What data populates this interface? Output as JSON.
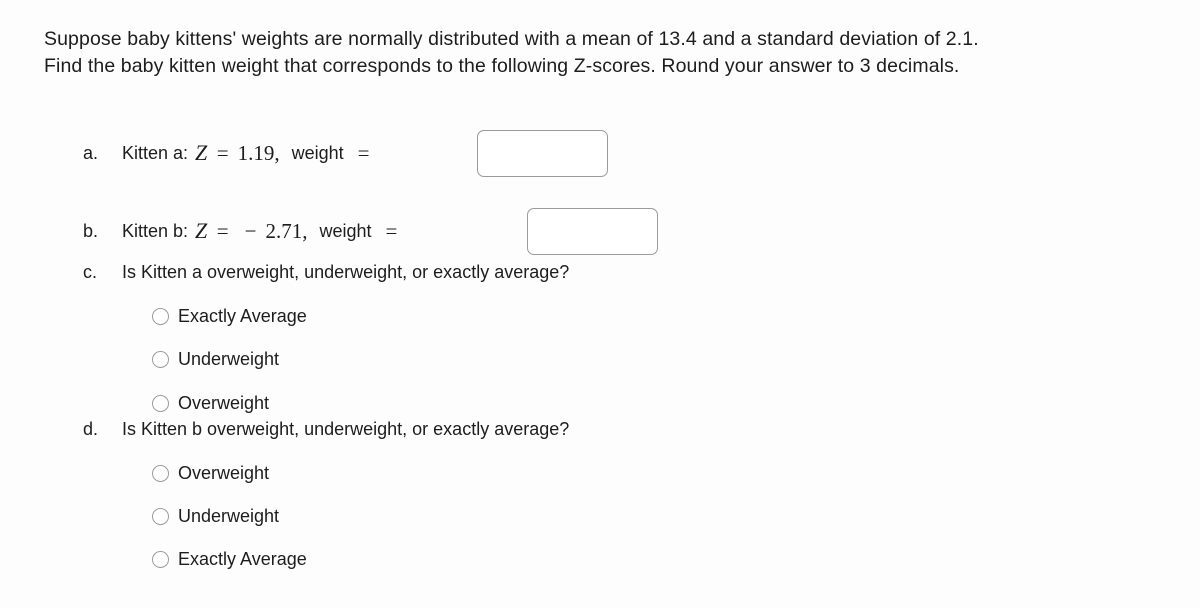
{
  "prompt": {
    "line1": "Suppose baby kittens' weights are normally distributed with a mean of 13.4 and a standard deviation of 2.1.",
    "line2": "Find the baby kitten weight that corresponds to the following Z-scores. Round your answer to 3 decimals."
  },
  "questions": [
    {
      "marker": "a.",
      "lead": "Kitten a:",
      "variable": "Z",
      "equals": "=",
      "zvalue": "1.19,",
      "weight_word": "weight",
      "weight_equals": "=",
      "input_value": "",
      "input_placeholder": ""
    },
    {
      "marker": "b.",
      "lead": "Kitten b:",
      "variable": "Z",
      "equals": "=",
      "minus": "−",
      "zvalue": "2.71,",
      "weight_word": "weight",
      "weight_equals": "=",
      "input_value": "",
      "input_placeholder": ""
    },
    {
      "marker": "c.",
      "question": "Is Kitten a overweight, underweight, or exactly average?",
      "options": [
        {
          "label": "Exactly Average",
          "selected": false
        },
        {
          "label": "Underweight",
          "selected": false
        },
        {
          "label": "Overweight",
          "selected": false
        }
      ]
    },
    {
      "marker": "d.",
      "question": "Is Kitten b overweight, underweight, or exactly average?",
      "options": [
        {
          "label": "Overweight",
          "selected": false
        },
        {
          "label": "Underweight",
          "selected": false
        },
        {
          "label": "Exactly Average",
          "selected": false
        }
      ]
    }
  ],
  "colors": {
    "background": "#fdfdfd",
    "text": "#1d1d1f",
    "input_border": "#9a9a9a",
    "radio_border": "#9c9c9c"
  }
}
